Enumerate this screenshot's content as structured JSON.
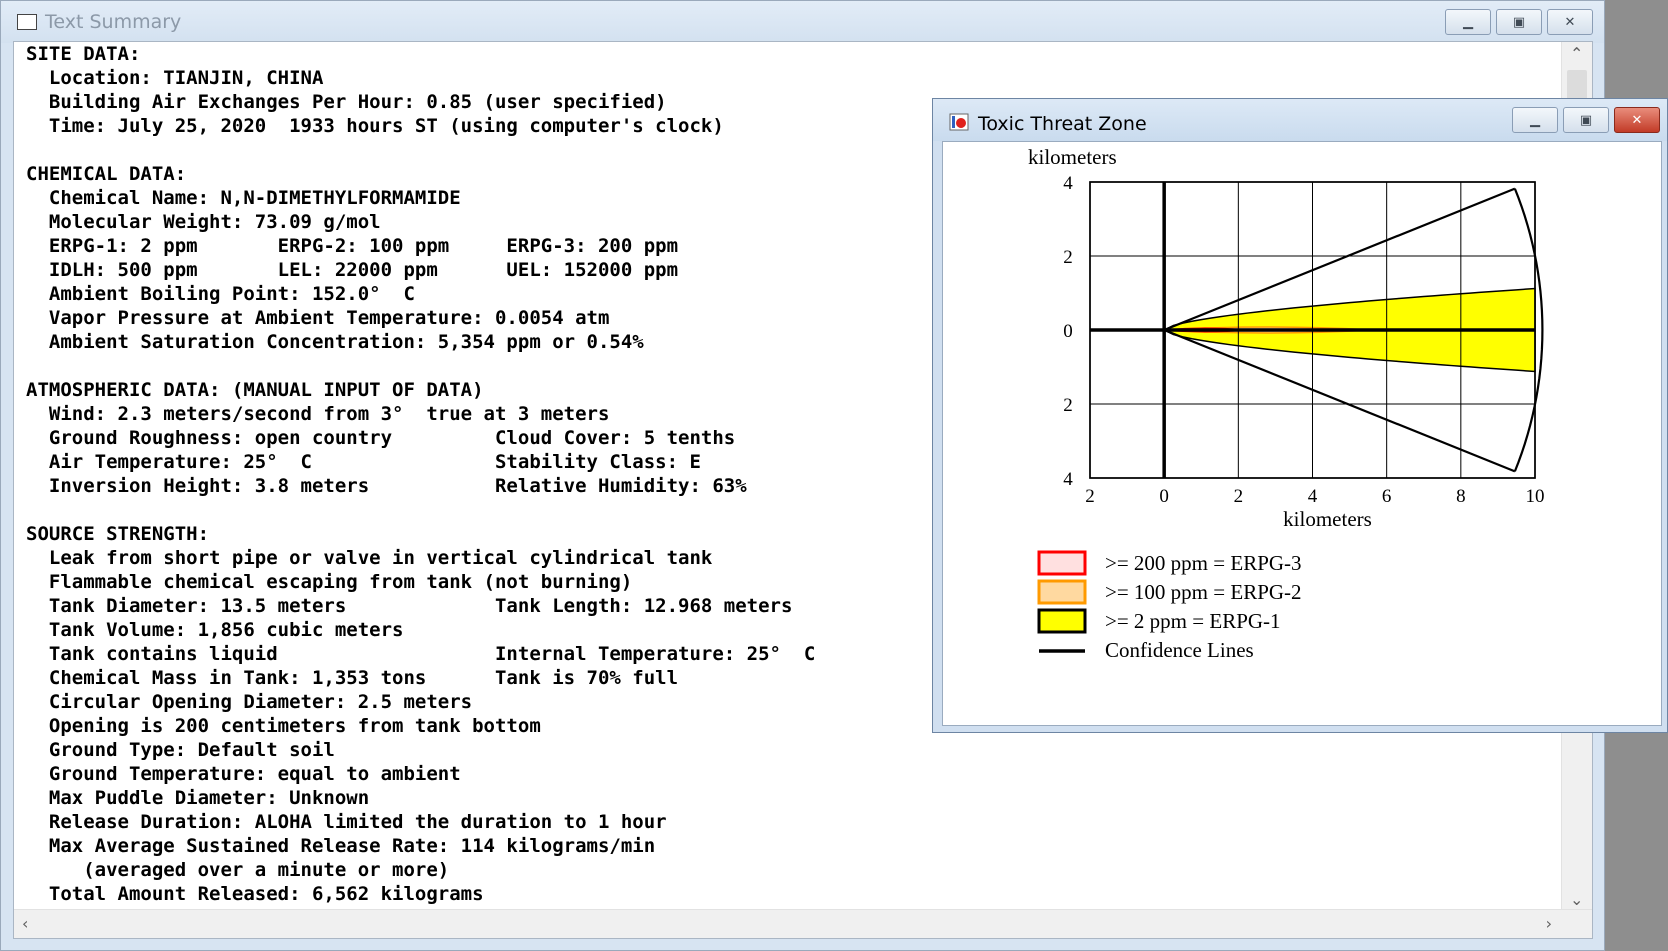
{
  "text_window": {
    "title": "Text Summary",
    "lines": [
      "SITE DATA:",
      "  Location: TIANJIN, CHINA",
      "  Building Air Exchanges Per Hour: 0.85 (user specified)",
      "  Time: July 25, 2020  1933 hours ST (using computer's clock)",
      "",
      "CHEMICAL DATA:",
      "  Chemical Name: N,N-DIMETHYLFORMAMIDE",
      "  Molecular Weight: 73.09 g/mol",
      "  ERPG-1: 2 ppm       ERPG-2: 100 ppm     ERPG-3: 200 ppm",
      "  IDLH: 500 ppm       LEL: 22000 ppm      UEL: 152000 ppm",
      "  Ambient Boiling Point: 152.0°  C",
      "  Vapor Pressure at Ambient Temperature: 0.0054 atm",
      "  Ambient Saturation Concentration: 5,354 ppm or 0.54%",
      "",
      "ATMOSPHERIC DATA: (MANUAL INPUT OF DATA)",
      "  Wind: 2.3 meters/second from 3°  true at 3 meters",
      "  Ground Roughness: open country         Cloud Cover: 5 tenths",
      "  Air Temperature: 25°  C                Stability Class: E",
      "  Inversion Height: 3.8 meters           Relative Humidity: 63%",
      "",
      "SOURCE STRENGTH:",
      "  Leak from short pipe or valve in vertical cylindrical tank",
      "  Flammable chemical escaping from tank (not burning)",
      "  Tank Diameter: 13.5 meters             Tank Length: 12.968 meters",
      "  Tank Volume: 1,856 cubic meters",
      "  Tank contains liquid                   Internal Temperature: 25°  C",
      "  Chemical Mass in Tank: 1,353 tons      Tank is 70% full",
      "  Circular Opening Diameter: 2.5 meters",
      "  Opening is 200 centimeters from tank bottom",
      "  Ground Type: Default soil",
      "  Ground Temperature: equal to ambient",
      "  Max Puddle Diameter: Unknown",
      "  Release Duration: ALOHA limited the duration to 1 hour",
      "  Max Average Sustained Release Rate: 114 kilograms/min",
      "     (averaged over a minute or more)",
      "  Total Amount Released: 6,562 kilograms"
    ]
  },
  "threat_window": {
    "title": "Toxic Threat Zone",
    "chart_data": {
      "type": "area",
      "ylabel": "kilometers",
      "xlabel": "kilometers",
      "xlim": [
        -2,
        10
      ],
      "ylim": [
        -4,
        4
      ],
      "x_ticks": [
        -2,
        0,
        2,
        4,
        6,
        8,
        10
      ],
      "x_tick_labels": [
        "2",
        "0",
        "2",
        "4",
        "6",
        "8",
        "10"
      ],
      "y_ticks": [
        4,
        2,
        0,
        -2,
        -4
      ],
      "y_tick_labels": [
        "4",
        "2",
        "0",
        "2",
        "4"
      ],
      "grid": true,
      "zones": [
        {
          "name": ">= 200 ppm = ERPG-3",
          "color": "#ff0000",
          "fill": "#ffffff",
          "max_x": 2.2,
          "max_halfwidth": 0.05
        },
        {
          "name": ">= 100 ppm = ERPG-2",
          "color": "#ff9a00",
          "fill": "#ffd9a0",
          "max_x": 5.6,
          "max_halfwidth": 0.08
        },
        {
          "name": ">= 2 ppm = ERPG-1",
          "color": "#000000",
          "fill": "#ffff00",
          "max_x": 10,
          "max_halfwidth": 1.12
        }
      ],
      "confidence_lines": {
        "name": "Confidence Lines",
        "color": "#000000",
        "spread_deg": 22,
        "max_range_km": 10.2
      },
      "legend": [
        {
          "label": ">= 200 ppm = ERPG-3",
          "swatch": "red"
        },
        {
          "label": ">= 100 ppm = ERPG-2",
          "swatch": "orange"
        },
        {
          "label": ">= 2 ppm = ERPG-1",
          "swatch": "yellow"
        },
        {
          "label": "Confidence Lines",
          "swatch": "line"
        }
      ]
    }
  }
}
